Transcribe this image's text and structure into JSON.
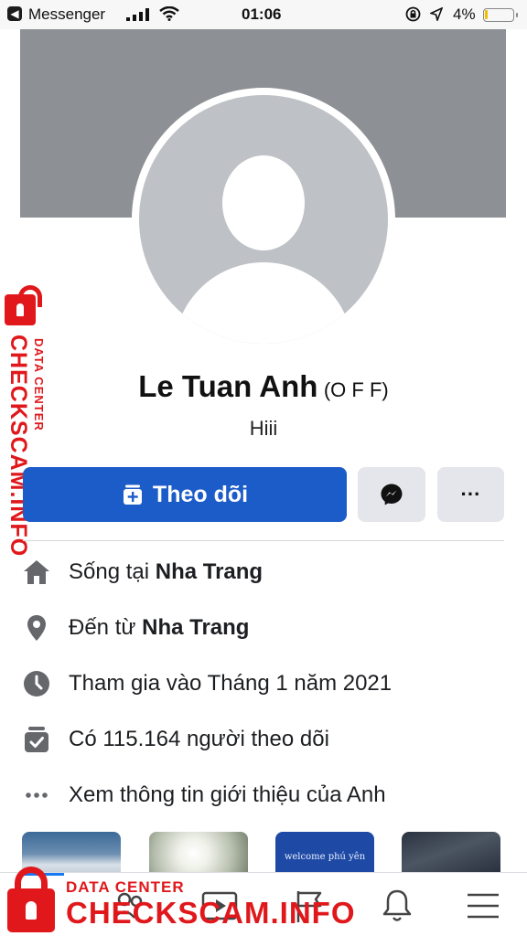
{
  "status_bar": {
    "back_app": "Messenger",
    "time": "01:06",
    "battery": "4%"
  },
  "profile": {
    "name": "Le Tuan Anh",
    "name_suffix": "(O F F)",
    "bio": "Hiii"
  },
  "actions": {
    "follow_label": "Theo dõi",
    "more_label": "···"
  },
  "info": [
    {
      "icon": "home-icon",
      "prefix": "Sống tại ",
      "bold": "Nha Trang"
    },
    {
      "icon": "location-pin-icon",
      "prefix": "Đến từ ",
      "bold": "Nha Trang"
    },
    {
      "icon": "clock-icon",
      "text": "Tham gia vào Tháng 1 năm 2021"
    },
    {
      "icon": "followers-icon",
      "text": "Có 115.164 người theo dõi"
    },
    {
      "icon": "more-dots-icon",
      "text": "Xem thông tin giới thiệu của Anh"
    }
  ],
  "photos": {
    "third_caption": "welcome phú yên"
  },
  "watermark": {
    "small": "DATA CENTER",
    "big": "CHECKSCAM.INFO"
  },
  "colors": {
    "accent": "#1c5cc9",
    "cover": "#8d9094",
    "watermark": "#e0181c"
  }
}
